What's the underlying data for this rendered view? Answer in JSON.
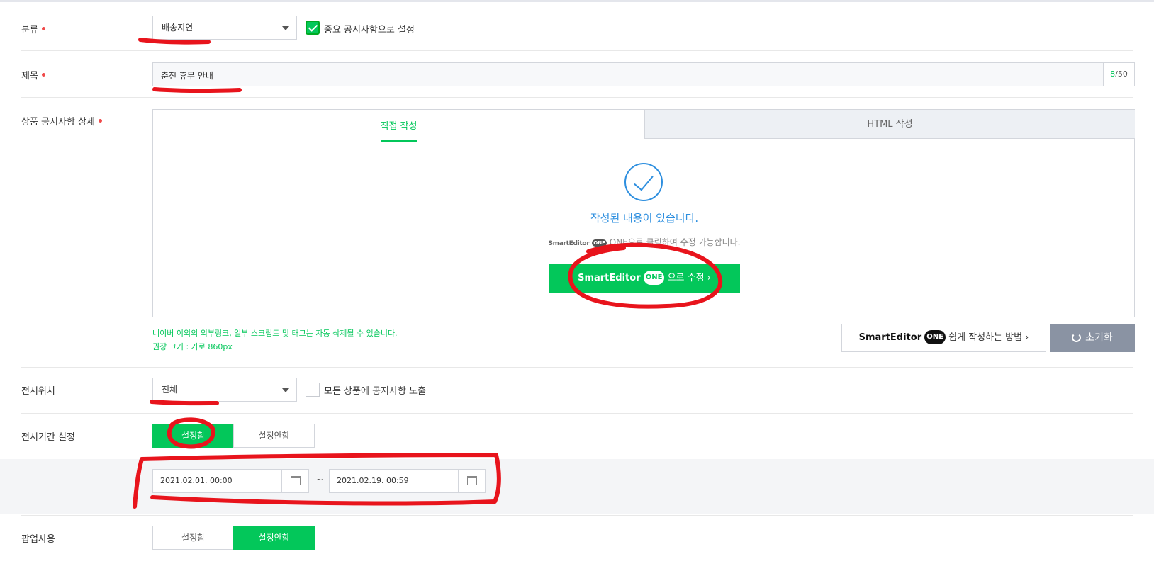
{
  "category": {
    "label": "분류",
    "value": "배송지연",
    "important_label": "중요 공지사항으로 설정",
    "important_checked": true
  },
  "title": {
    "label": "제목",
    "value": "춘전 휴무 안내",
    "count": "8",
    "max": "/50"
  },
  "detail": {
    "label": "상품 공지사항 상세",
    "tab_direct": "직접 작성",
    "tab_html": "HTML 작성",
    "written_message": "작성된 내용이 있습니다.",
    "se_logo": "SmartEditor",
    "se_one": "ONE",
    "se_note_text": "ONE으로 클릭하여 수정 가능합니다.",
    "edit_button_brand": "SmartEditor",
    "edit_button_one": "ONE",
    "edit_button_text": "으로 수정 ›",
    "notice_line1": "네이버 이외의 외부링크, 일부 스크립트 및 태그는 자동 삭제될 수 있습니다.",
    "notice_line2": "권장 크기 : 가로 860px",
    "howto_brand": "SmartEditor",
    "howto_one": "ONE",
    "howto_text": "쉽게 작성하는 방법 ›",
    "reset_label": "초기화"
  },
  "display_position": {
    "label": "전시위치",
    "value": "전체",
    "expose_all_label": "모든 상품에 공지사항 노출",
    "expose_all_checked": false
  },
  "display_period": {
    "label": "전시기간 설정",
    "set_label": "설정함",
    "unset_label": "설정안함",
    "selected": "설정함",
    "start": "2021.02.01. 00:00",
    "separator": "~",
    "end": "2021.02.19. 00:59"
  },
  "popup": {
    "label": "팝업사용",
    "set_label": "설정함",
    "unset_label": "설정안함",
    "selected": "설정안함"
  },
  "colors": {
    "accent_green": "#03c75a",
    "info_blue": "#2e8fdf",
    "required_red": "#f04a4a",
    "annotation_red": "#e8141c"
  }
}
